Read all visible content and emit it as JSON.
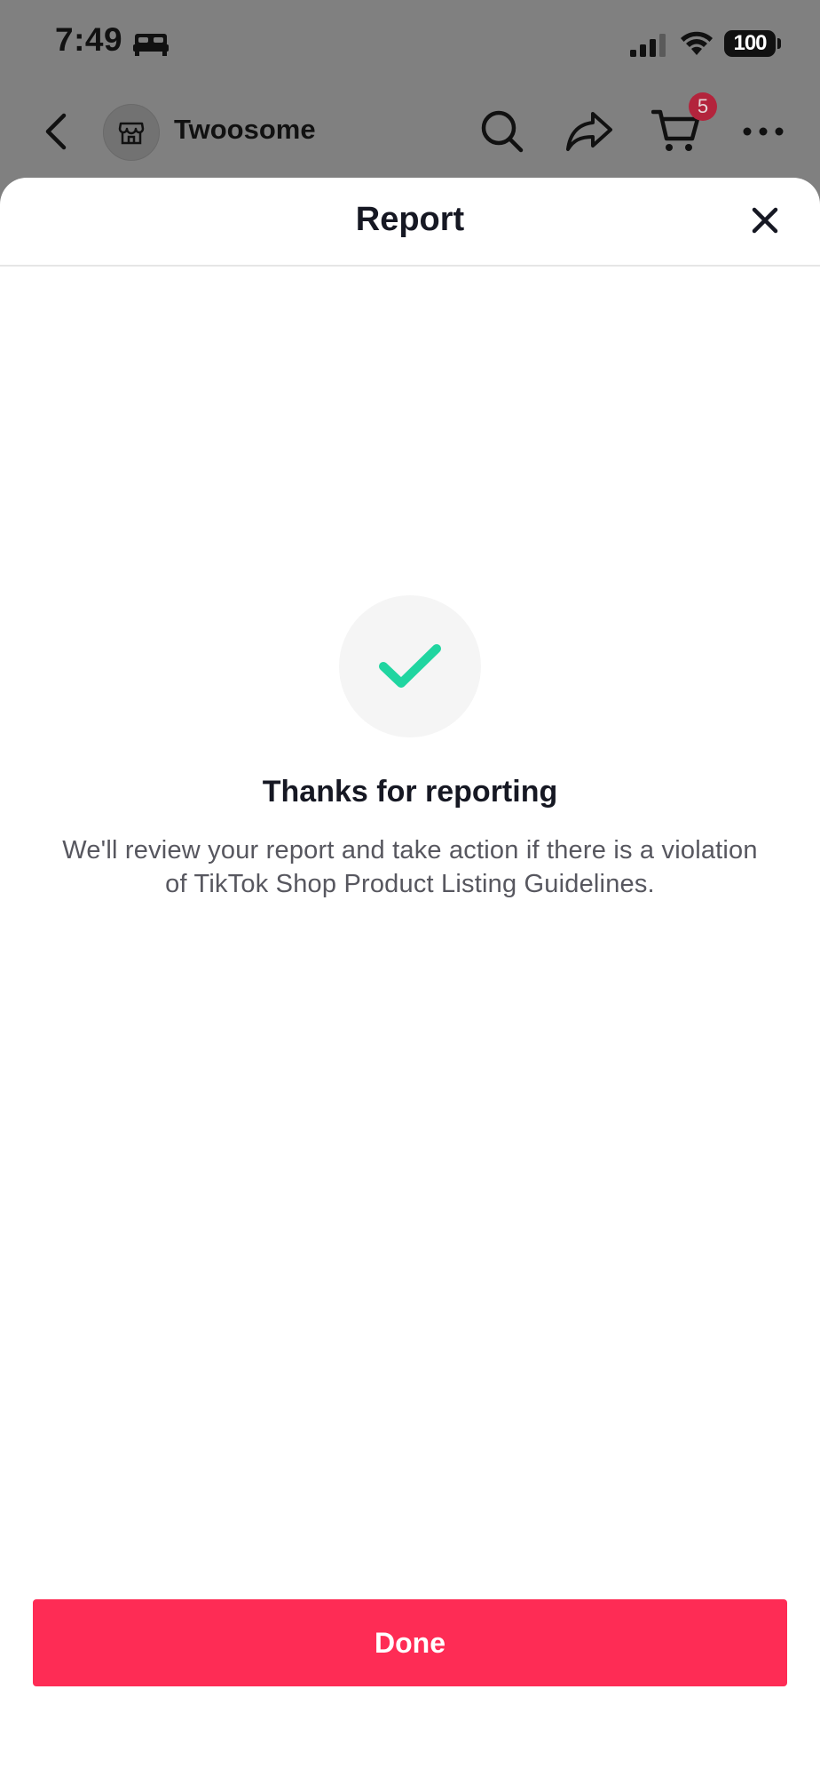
{
  "status_bar": {
    "time": "7:49",
    "battery_level": "100"
  },
  "background_header": {
    "store_name": "Twoosome",
    "cart_count": "5"
  },
  "sheet": {
    "title": "Report",
    "confirmation_title": "Thanks for reporting",
    "confirmation_message": "We'll review your report and take action if there is a violation of TikTok Shop Product Listing Guidelines.",
    "done_label": "Done"
  },
  "colors": {
    "accent": "#fe2c55",
    "check": "#20d5a0",
    "badge": "#b3243c",
    "overlay": "#808080"
  },
  "icons": [
    "bed-icon",
    "signal-icon",
    "wifi-icon",
    "battery-icon",
    "back-icon",
    "store-icon",
    "search-icon",
    "share-icon",
    "cart-icon",
    "more-icon",
    "close-icon",
    "checkmark-icon"
  ]
}
